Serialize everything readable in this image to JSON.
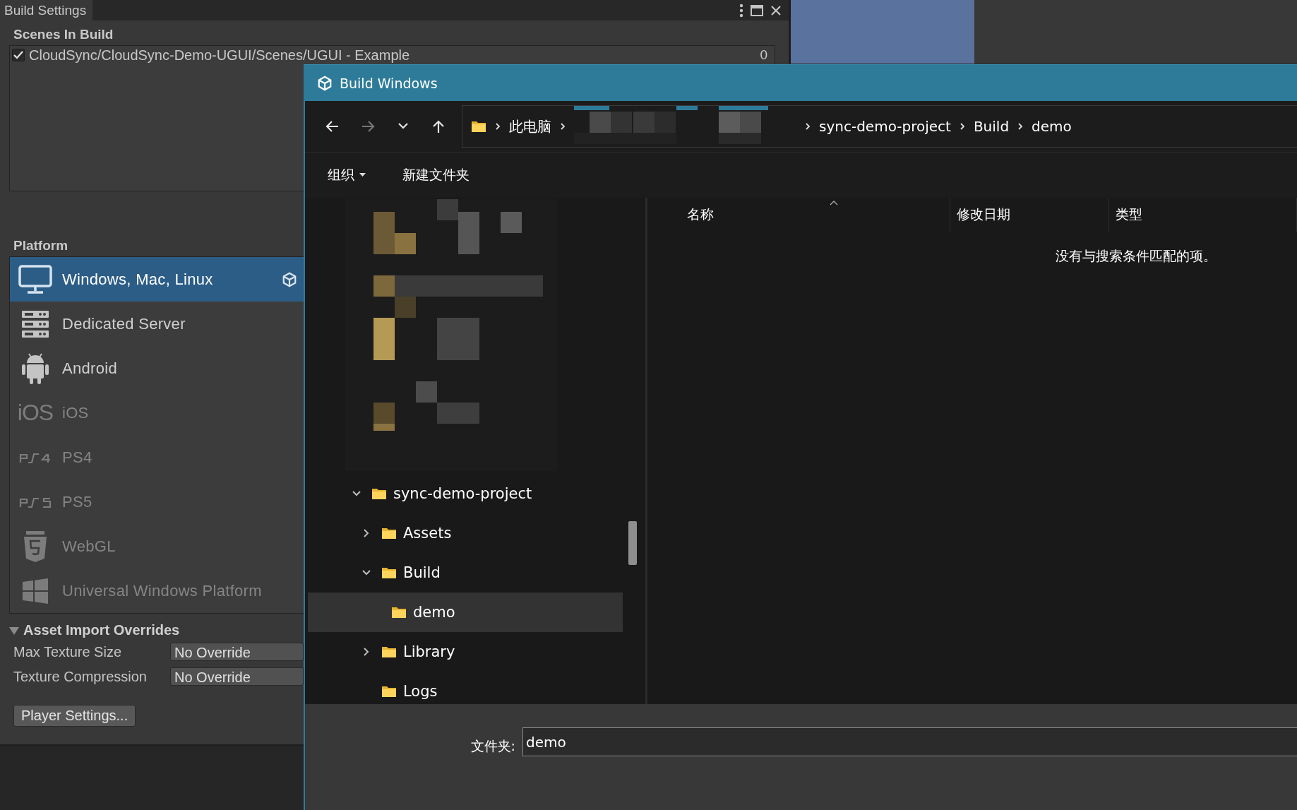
{
  "build_settings": {
    "tab": "Build Settings",
    "scenes_heading": "Scenes In Build",
    "scenes": [
      {
        "path": "CloudSync/CloudSync-Demo-UGUI/Scenes/UGUI - Example",
        "index": "0",
        "checked": true
      }
    ],
    "platform_heading": "Platform",
    "platforms": [
      {
        "kind": "desktop",
        "name": "Windows, Mac, Linux",
        "selected": true,
        "disabled": false,
        "active": true
      },
      {
        "kind": "server",
        "name": "Dedicated Server",
        "selected": false,
        "disabled": false,
        "active": false
      },
      {
        "kind": "android",
        "name": "Android",
        "selected": false,
        "disabled": false,
        "active": false
      },
      {
        "kind": "ios",
        "logo": "iOS",
        "name": "iOS",
        "selected": false,
        "disabled": true,
        "active": false
      },
      {
        "kind": "ps4",
        "name": "PS4",
        "selected": false,
        "disabled": true,
        "active": false
      },
      {
        "kind": "ps5",
        "name": "PS5",
        "selected": false,
        "disabled": true,
        "active": false
      },
      {
        "kind": "webgl",
        "name": "WebGL",
        "selected": false,
        "disabled": true,
        "active": false
      },
      {
        "kind": "uwp",
        "name": "Universal Windows Platform",
        "selected": false,
        "disabled": true,
        "active": false
      }
    ],
    "overrides": {
      "heading": "Asset Import Overrides",
      "expanded": true,
      "rows": [
        {
          "label": "Max Texture Size",
          "value": "No Override"
        },
        {
          "label": "Texture Compression",
          "value": "No Override"
        }
      ]
    },
    "player_settings_button": "Player Settings..."
  },
  "dialog": {
    "title": "Build Windows",
    "nav": [
      {
        "kind": "back",
        "disabled": false
      },
      {
        "kind": "forward",
        "disabled": true
      },
      {
        "kind": "recent",
        "disabled": false
      },
      {
        "kind": "up",
        "disabled": false
      }
    ],
    "breadcrumb": [
      {
        "kind": "text",
        "label": "此电脑"
      },
      {
        "kind": "hidden"
      },
      {
        "kind": "text",
        "label": "sync-demo-project"
      },
      {
        "kind": "text",
        "label": "Build"
      },
      {
        "kind": "text",
        "label": "demo"
      }
    ],
    "toolbar": [
      {
        "label": "组织",
        "dropdown": true
      },
      {
        "label": "新建文件夹",
        "dropdown": false
      }
    ],
    "columns": [
      "名称",
      "修改日期",
      "类型"
    ],
    "empty_message": "没有与搜索条件匹配的项。",
    "tree": [
      {
        "label": "sync-demo-project",
        "expanded": true,
        "selected": false,
        "children": [
          {
            "label": "Assets",
            "expanded": false,
            "selected": false
          },
          {
            "label": "Build",
            "expanded": true,
            "selected": false,
            "children": [
              {
                "label": "demo",
                "selected": true
              }
            ]
          },
          {
            "label": "Library",
            "expanded": false,
            "selected": false
          },
          {
            "label": "Logs",
            "selected": false
          }
        ]
      }
    ],
    "folder_label": "文件夹:",
    "folder_value": "demo"
  }
}
